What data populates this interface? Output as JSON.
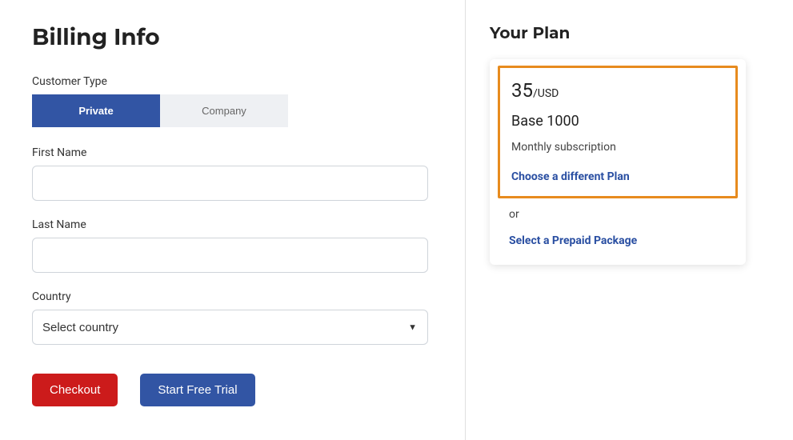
{
  "billing": {
    "title": "Billing Info",
    "customer_type_label": "Customer Type",
    "segment_private": "Private",
    "segment_company": "Company",
    "first_name_label": "First Name",
    "first_name_value": "",
    "last_name_label": "Last Name",
    "last_name_value": "",
    "country_label": "Country",
    "country_placeholder": "Select country",
    "checkout_label": "Checkout",
    "start_trial_label": "Start Free Trial"
  },
  "plan": {
    "title": "Your Plan",
    "price_value": "35",
    "price_currency": "/USD",
    "name": "Base 1000",
    "subscription_type": "Monthly subscription",
    "choose_different_label": "Choose a different Plan",
    "or_label": "or",
    "select_prepaid_label": "Select a Prepaid Package"
  }
}
